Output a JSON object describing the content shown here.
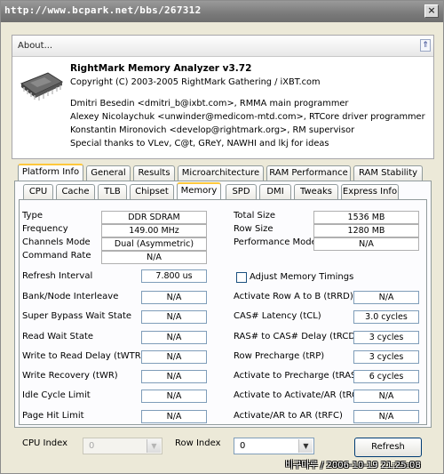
{
  "window": {
    "title": "http://www.bcpark.net/bbs/267312",
    "close_glyph": "×"
  },
  "about": {
    "header_label": "About...",
    "collapse_glyph": "⇑",
    "app_name": "RightMark Memory Analyzer v3.72",
    "copyright": "Copyright (C) 2003-2005 RightMark Gathering / iXBT.com",
    "credits": [
      "Dmitri Besedin <dmitri_b@ixbt.com>, RMMA main programmer",
      "Alexey Nicolaychuk <unwinder@medicom-mtd.com>, RTCore driver programmer",
      "Konstantin Mironovich <develop@rightmark.org>, RM supervisor",
      "Special thanks to VLev, C@t, GReY, NAWHI and lkj for ideas"
    ]
  },
  "tabs_main": [
    "Platform Info",
    "General",
    "Results",
    "Microarchitecture",
    "RAM Performance",
    "RAM Stability"
  ],
  "tabs_sub": [
    "CPU",
    "Cache",
    "TLB",
    "Chipset",
    "Memory",
    "SPD",
    "DMI",
    "Tweaks",
    "Express Info"
  ],
  "memory": {
    "type_label": "Type",
    "type_value": "DDR SDRAM",
    "frequency_label": "Frequency",
    "frequency_value": "149.00 MHz",
    "channels_label": "Channels Mode",
    "channels_value": "Dual (Asymmetric)",
    "command_rate_label": "Command Rate",
    "command_rate_value": "N/A",
    "total_size_label": "Total Size",
    "total_size_value": "1536 MB",
    "row_size_label": "Row Size",
    "row_size_value": "1280 MB",
    "perf_mode_label": "Performance Mode",
    "perf_mode_value": "N/A",
    "refresh_label": "Refresh Interval",
    "refresh_value": "7.800 us",
    "adjust_label": "Adjust Memory Timings",
    "left_params": [
      {
        "label": "Bank/Node Interleave",
        "value": "N/A"
      },
      {
        "label": "Super Bypass Wait State",
        "value": "N/A"
      },
      {
        "label": "Read Wait State",
        "value": "N/A"
      },
      {
        "label": "Write to Read Delay (tWTR)",
        "value": "N/A"
      },
      {
        "label": "Write Recovery (tWR)",
        "value": "N/A"
      },
      {
        "label": "Idle Cycle Limit",
        "value": "N/A"
      },
      {
        "label": "Page Hit Limit",
        "value": "N/A"
      }
    ],
    "right_params": [
      {
        "label": "Activate Row A to B (tRRD)",
        "value": "N/A"
      },
      {
        "label": "CAS# Latency (tCL)",
        "value": "3.0 cycles"
      },
      {
        "label": "RAS# to CAS# Delay (tRCD)",
        "value": "3 cycles"
      },
      {
        "label": "Row Precharge (tRP)",
        "value": "3 cycles"
      },
      {
        "label": "Activate to Precharge (tRAS)",
        "value": "6 cycles"
      },
      {
        "label": "Activate to Activate/AR (tRC)",
        "value": "N/A"
      },
      {
        "label": "Activate/AR to AR (tRFC)",
        "value": "N/A"
      }
    ]
  },
  "bottom": {
    "cpu_index_label": "CPU Index",
    "cpu_index_value": "0",
    "row_index_label": "Row Index",
    "row_index_value": "0",
    "refresh_button": "Refresh",
    "arrow_glyph": "▼"
  },
  "watermark": "비구마루 / 2006-10-19 21:25:08",
  "colors": {
    "titlebar": "#7a7a7a",
    "tab_accent": "#ffc83c",
    "panel_bg": "#fcfcfe",
    "field_border": "#7f9db9"
  }
}
